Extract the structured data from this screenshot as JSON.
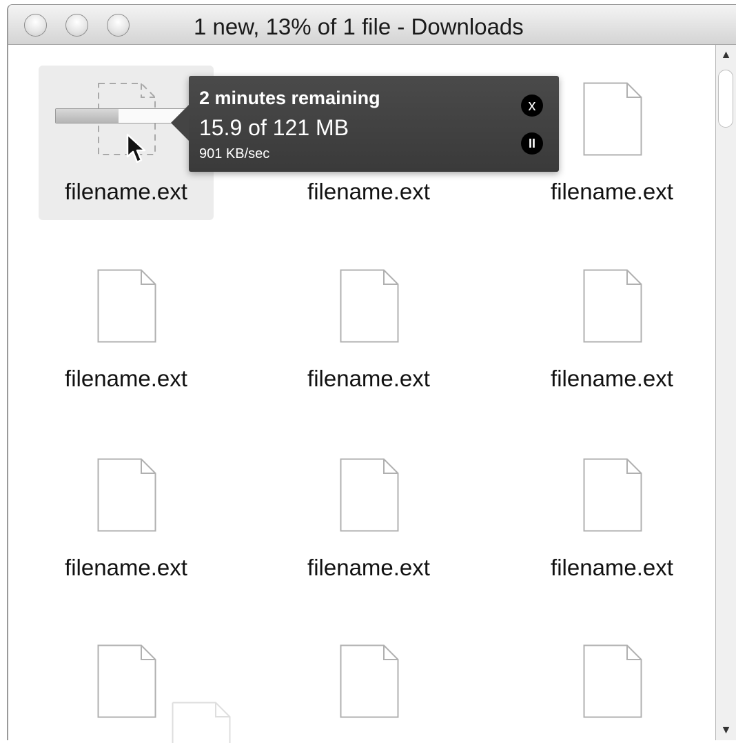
{
  "window": {
    "title": "1 new, 13% of 1 file - Downloads"
  },
  "download": {
    "status": "2 minutes remaining",
    "amount": "15.9 of 121 MB",
    "speed": "901 KB/sec",
    "progress_fraction": 0.45,
    "cancel_label": "x",
    "pause_label": "II"
  },
  "files": [
    {
      "name": "filename.ext"
    },
    {
      "name": "filename.ext"
    },
    {
      "name": "filename.ext"
    },
    {
      "name": "filename.ext"
    },
    {
      "name": "filename.ext"
    },
    {
      "name": "filename.ext"
    },
    {
      "name": "filename.ext"
    },
    {
      "name": "filename.ext"
    },
    {
      "name": "filename.ext"
    },
    {
      "name": "",
      "partial": true
    },
    {
      "name": "",
      "partial": true
    },
    {
      "name": "",
      "partial": true
    }
  ],
  "icons": {
    "file": "file-icon",
    "downloading": "downloading-file-icon",
    "cursor": "pointer-cursor-icon"
  },
  "colors": {
    "popover_bg": "#3f3f3f",
    "selection_bg": "#ececec",
    "icon_stroke": "#b0b0b0"
  }
}
